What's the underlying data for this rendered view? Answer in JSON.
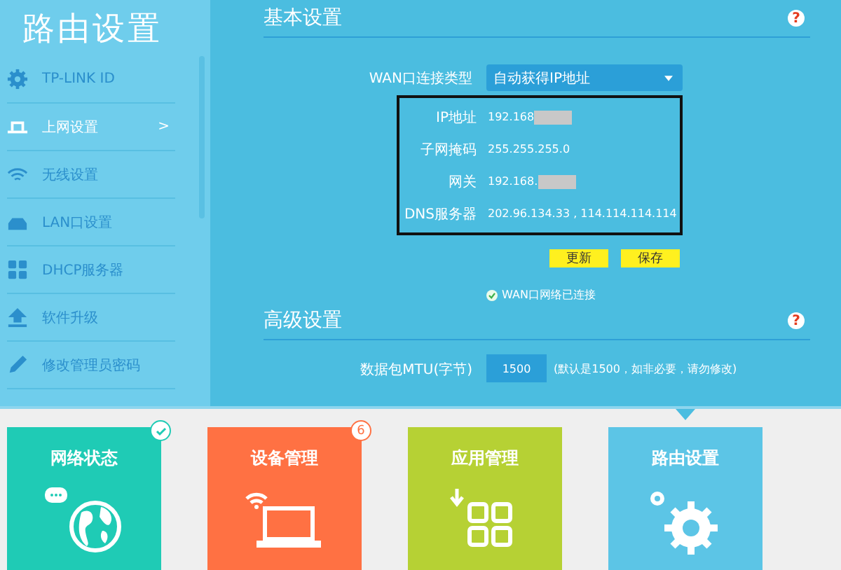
{
  "sidebar": {
    "title": "路由设置",
    "items": [
      {
        "kind": "gear",
        "label": "TP-LINK ID",
        "selected": false
      },
      {
        "kind": "laptop",
        "label": "上网设置",
        "selected": true,
        "arrow": ">"
      },
      {
        "kind": "wifi",
        "label": "无线设置",
        "selected": false
      },
      {
        "kind": "lan",
        "label": "LAN口设置",
        "selected": false
      },
      {
        "kind": "dhcp",
        "label": "DHCP服务器",
        "selected": false
      },
      {
        "kind": "upload",
        "label": "软件升级",
        "selected": false
      },
      {
        "kind": "pencil",
        "label": "修改管理员密码",
        "selected": false
      }
    ]
  },
  "basic": {
    "title": "基本设置",
    "help": "?",
    "wan_type": {
      "label": "WAN口连接类型",
      "value": "自动获得IP地址"
    },
    "details": [
      {
        "label": "IP地址",
        "value": "192.168",
        "redacted": true
      },
      {
        "label": "子网掩码",
        "value": "255.255.255.0"
      },
      {
        "label": "网关",
        "value": "192.168.",
        "redacted": true
      },
      {
        "label": "DNS服务器",
        "value": "202.96.134.33 , 114.114.114.114"
      }
    ],
    "buttons": [
      "更新",
      "保存"
    ],
    "status": {
      "text": "WAN口网络已连接",
      "connected": true
    }
  },
  "advanced": {
    "title": "高级设置",
    "help": "?",
    "mtu": {
      "label": "数据包MTU(字节)",
      "value": "1500",
      "hint": "(默认是1500，如非必要，请勿修改)"
    }
  },
  "tiles": [
    {
      "kind": "globe",
      "label": "网络状态",
      "color": "#1fcbb5",
      "badge": {
        "kind": "check"
      },
      "selected": false
    },
    {
      "kind": "laptop",
      "label": "设备管理",
      "color": "#ff7143",
      "badge": {
        "kind": "count",
        "text": "6"
      },
      "selected": false
    },
    {
      "kind": "apps",
      "label": "应用管理",
      "color": "#b6d134",
      "selected": false
    },
    {
      "kind": "gear",
      "label": "路由设置",
      "color": "#5cc5e6",
      "selected": true
    }
  ]
}
